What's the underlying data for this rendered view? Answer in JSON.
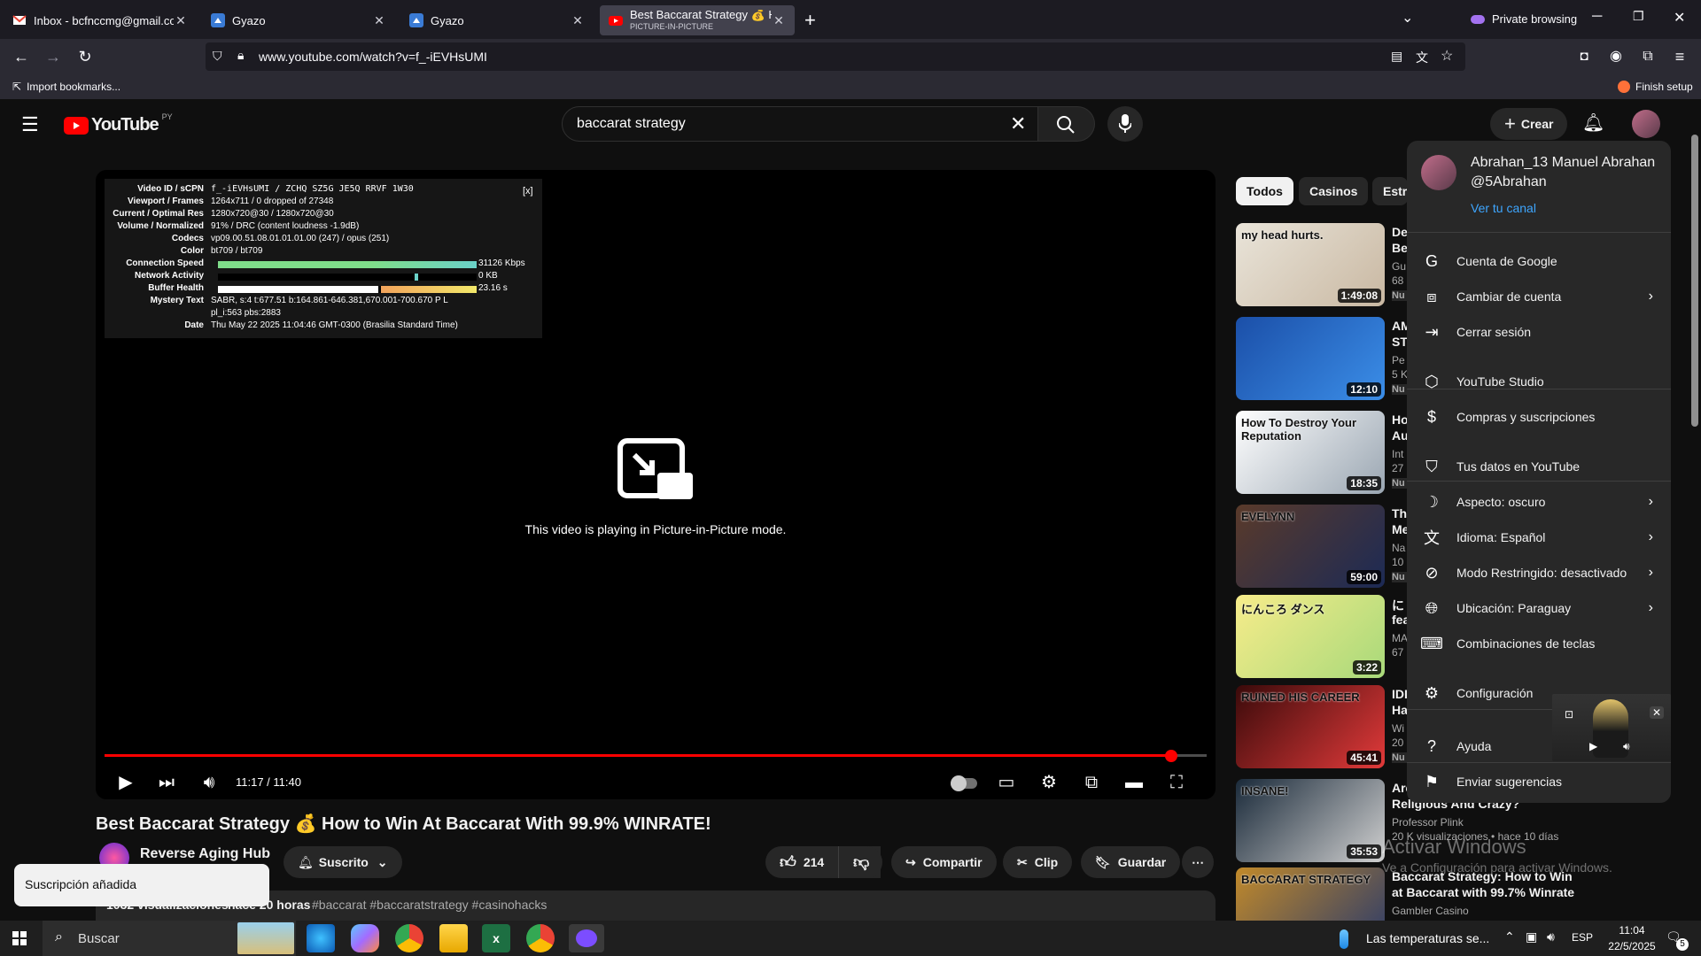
{
  "browser": {
    "tabs": [
      {
        "title": "Inbox - bcfnccmg@gmail.com -",
        "active": false
      },
      {
        "title": "Gyazo",
        "active": false
      },
      {
        "title": "Gyazo",
        "active": false
      },
      {
        "title": "Best Baccarat Strategy 💰 How",
        "subtitle": "PICTURE-IN-PICTURE",
        "active": true
      }
    ],
    "private_label": "Private browsing",
    "url": "www.youtube.com/watch?v=f_-iEVHsUMI",
    "import_bookmarks": "Import bookmarks...",
    "finish_setup": "Finish setup"
  },
  "youtube": {
    "logo_text": "YouTube",
    "logo_country": "PY",
    "search_value": "baccarat strategy",
    "create_label": "Crear"
  },
  "player": {
    "pip_message": "This video is playing in Picture-in-Picture mode.",
    "time_display": "11:17 / 11:40",
    "progress_fraction": 0.968,
    "stats_close": "[x]",
    "stats": [
      {
        "label": "Video ID / sCPN",
        "value": "f_-iEVHsUMI / ZCHQ SZ5G JE5Q RRVF 1W30"
      },
      {
        "label": "Viewport / Frames",
        "value": "1264x711 / 0 dropped of 27348"
      },
      {
        "label": "Current / Optimal Res",
        "value": "1280x720@30 / 1280x720@30"
      },
      {
        "label": "Volume / Normalized",
        "value": "91% / DRC (content loudness -1.9dB)"
      },
      {
        "label": "Codecs",
        "value": "vp09.00.51.08.01.01.01.00 (247) / opus (251)"
      },
      {
        "label": "Color",
        "value": "bt709 / bt709"
      },
      {
        "label": "Connection Speed",
        "value": "31126 Kbps"
      },
      {
        "label": "Network Activity",
        "value": "0 KB"
      },
      {
        "label": "Buffer Health",
        "value": "23.16 s"
      },
      {
        "label": "Mystery Text",
        "value": "SABR, s:4 t:677.51 b:164.861-646.381,670.001-700.670 P L"
      },
      {
        "label": "",
        "value": "pl_i:563 pbs:2883"
      },
      {
        "label": "Date",
        "value": "Thu May 22 2025 11:04:46 GMT-0300 (Brasilia Standard Time)"
      }
    ]
  },
  "video": {
    "title": "Best Baccarat Strategy 💰 How to Win At Baccarat With 99.9% WINRATE!",
    "channel": "Reverse Aging Hub",
    "subscribed_label": "Suscrito",
    "likes": "214",
    "share_label": "Compartir",
    "clip_label": "Clip",
    "save_label": "Guardar",
    "views": "1032 visualizaciones",
    "age": "hace 20 horas",
    "hashtags": "#baccarat #baccaratstrategy #casinohacks"
  },
  "toast": "Suscripción añadida",
  "chips": [
    "Todos",
    "Casinos",
    "Estra"
  ],
  "recommendations": [
    {
      "duration": "1:49:08",
      "title": "De",
      "title2": "Be",
      "meta": "Gu",
      "meta2": "68",
      "badge": "Nu",
      "thumb_text": "my head hurts."
    },
    {
      "duration": "12:10",
      "title": "AM",
      "title2": "ST",
      "meta": "Pe",
      "meta2": "5 K",
      "badge": "Nu",
      "thumb_text": ""
    },
    {
      "duration": "18:35",
      "title": "Ho",
      "title2": "Au",
      "meta": "Int",
      "meta2": "27",
      "badge": "Nu",
      "thumb_text": "How To Destroy Your Reputation"
    },
    {
      "duration": "59:00",
      "title": "Th",
      "title2": "Me",
      "meta": "Na",
      "meta2": "10",
      "badge": "Nu",
      "thumb_text": "EVELYNN"
    },
    {
      "duration": "3:22",
      "title": "に",
      "title2": "fea",
      "meta": "MA",
      "meta2": "67",
      "badge": "",
      "thumb_text": "にんころ ダンス"
    },
    {
      "duration": "45:41",
      "title": "IDI",
      "title2": "Ha",
      "meta": "Wi",
      "meta2": "20",
      "badge": "Nu",
      "thumb_text": "RUINED HIS CAREER"
    },
    {
      "duration": "35:53",
      "title": "Are",
      "title2": "Religious And Crazy?",
      "meta": "Professor Plink",
      "meta2": "20 K visualizaciones • hace 10 días",
      "badge": "",
      "thumb_text": "INSANE!"
    },
    {
      "duration": "",
      "title": "Baccarat Strategy: How to Win",
      "title2": "at Baccarat with 99.7% Winrate",
      "meta": "Gambler Casino",
      "meta2": "",
      "badge": "",
      "thumb_text": "BACCARAT STRATEGY"
    }
  ],
  "account_menu": {
    "name": "Abrahan_13 Manuel Abrahan",
    "handle": "@5Abrahan",
    "channel_link": "Ver tu canal",
    "items": [
      {
        "label": "Cuenta de Google",
        "icon": "google-icon",
        "chevron": false
      },
      {
        "label": "Cambiar de cuenta",
        "icon": "switch-account-icon",
        "chevron": true
      },
      {
        "label": "Cerrar sesión",
        "icon": "sign-out-icon",
        "chevron": false
      },
      {
        "label": "YouTube Studio",
        "icon": "studio-icon",
        "chevron": false
      },
      {
        "label": "Compras y suscripciones",
        "icon": "purchases-icon",
        "chevron": false
      },
      {
        "label": "Tus datos en YouTube",
        "icon": "your-data-icon",
        "chevron": false
      },
      {
        "label": "Aspecto: oscuro",
        "icon": "appearance-icon",
        "chevron": true
      },
      {
        "label": "Idioma: Español",
        "icon": "language-icon",
        "chevron": true
      },
      {
        "label": "Modo Restringido: desactivado",
        "icon": "restricted-icon",
        "chevron": true
      },
      {
        "label": "Ubicación: Paraguay",
        "icon": "location-icon",
        "chevron": true
      },
      {
        "label": "Combinaciones de teclas",
        "icon": "keyboard-icon",
        "chevron": false
      },
      {
        "label": "Configuración",
        "icon": "settings-icon",
        "chevron": false
      },
      {
        "label": "Ayuda",
        "icon": "help-icon",
        "chevron": false
      },
      {
        "label": "Enviar sugerencias",
        "icon": "feedback-icon",
        "chevron": false
      }
    ]
  },
  "watermark": {
    "line1": "Activar Windows",
    "line2": "Ve a Configuración para activar Windows."
  },
  "taskbar": {
    "search_placeholder": "Buscar",
    "weather": "Las temperaturas se...",
    "lang": "ESP",
    "time": "11:04",
    "date": "22/5/2025",
    "notifications": "5"
  },
  "colors": {
    "accent": "#ff0000",
    "link": "#3ea6ff",
    "menu_bg": "#282828"
  }
}
